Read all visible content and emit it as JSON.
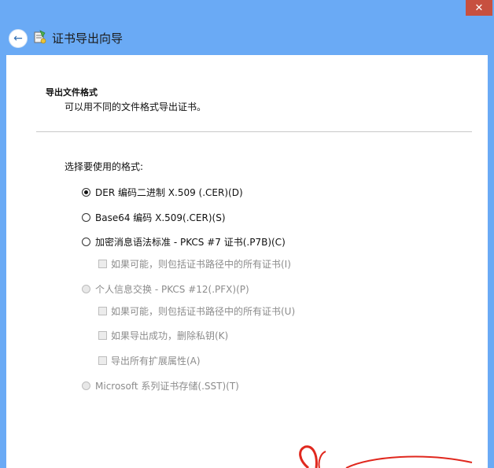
{
  "window": {
    "title": "证书导出向导",
    "close_glyph": "✕"
  },
  "page": {
    "section_title": "导出文件格式",
    "section_subtitle": "可以用不同的文件格式导出证书。",
    "prompt": "选择要使用的格式:"
  },
  "options": {
    "der": {
      "label": "DER 编码二进制 X.509 (.CER)(D)",
      "checked": true,
      "enabled": true
    },
    "base64": {
      "label": "Base64 编码 X.509(.CER)(S)",
      "checked": false,
      "enabled": true
    },
    "pkcs7": {
      "label": "加密消息语法标准 - PKCS #7 证书(.P7B)(C)",
      "checked": false,
      "enabled": true
    },
    "pkcs7_include_all": {
      "label": "如果可能，则包括证书路径中的所有证书(I)",
      "checked": false,
      "enabled": false
    },
    "pkcs12": {
      "label": "个人信息交换 - PKCS #12(.PFX)(P)",
      "checked": false,
      "enabled": false
    },
    "pkcs12_include_all": {
      "label": "如果可能，则包括证书路径中的所有证书(U)",
      "checked": false,
      "enabled": false
    },
    "pkcs12_delete_key": {
      "label": "如果导出成功，删除私钥(K)",
      "checked": false,
      "enabled": false
    },
    "pkcs12_export_ext": {
      "label": "导出所有扩展属性(A)",
      "checked": false,
      "enabled": false
    },
    "sst": {
      "label": "Microsoft 系列证书存储(.SST)(T)",
      "checked": false,
      "enabled": false
    }
  },
  "colors": {
    "titlebar": "#6aaaf5",
    "close": "#c7503f",
    "annotation": "#e0281e"
  }
}
